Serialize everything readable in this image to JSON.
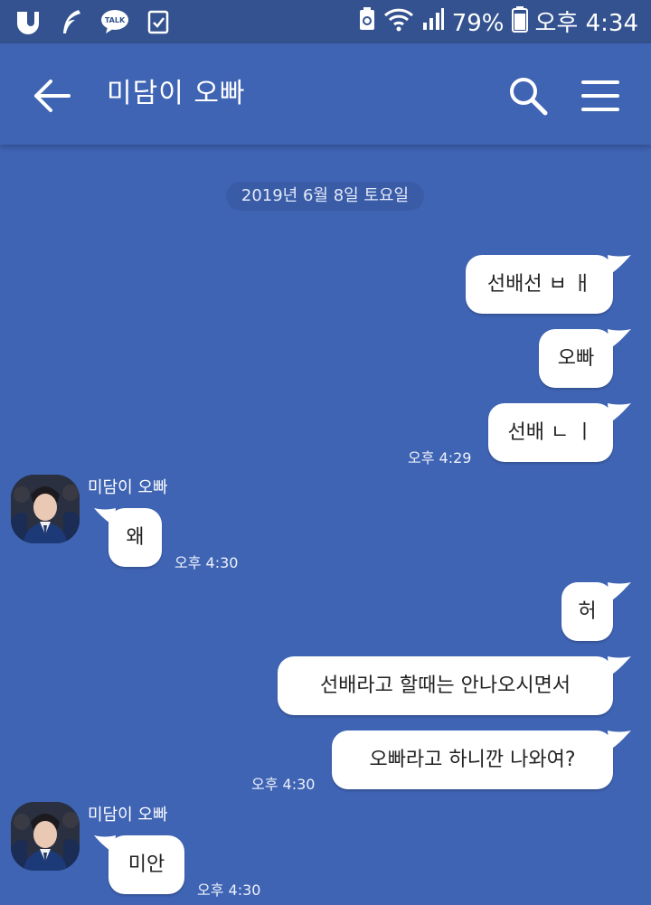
{
  "status_bar": {
    "battery": "79%",
    "time": "오후 4:34",
    "left_icons": [
      "u-plus-icon",
      "feather-icon",
      "talk-icon",
      "clipboard-check-icon"
    ],
    "right_icons": [
      "battery-saver-icon",
      "wifi-icon",
      "signal-icon",
      "battery-icon"
    ]
  },
  "header": {
    "title": "미담이 오빠",
    "back_icon": "arrow-left-icon",
    "search_icon": "search-icon",
    "menu_icon": "hamburger-menu-icon"
  },
  "chat": {
    "date": "2019년 6월 8일 토요일",
    "messages": [
      {
        "side": "right",
        "text": "선배선 ㅂ ㅐ"
      },
      {
        "side": "right",
        "text": "오빠"
      },
      {
        "side": "right",
        "text": "선배 ㄴ ㅣ",
        "time": "오후 4:29"
      },
      {
        "side": "left",
        "sender": "미담이 오빠",
        "text": "왜",
        "time": "오후 4:30"
      },
      {
        "side": "right",
        "text": "허"
      },
      {
        "side": "right",
        "text": "선배라고 할때는 안나오시면서"
      },
      {
        "side": "right",
        "text": "오빠라고 하니깐 나와여?",
        "time": "오후 4:30"
      },
      {
        "side": "left",
        "sender": "미담이 오빠",
        "text": "미안",
        "time": "오후 4:30"
      }
    ]
  },
  "colors": {
    "background": "#3f64b4",
    "status_bar": "#33528f",
    "bubble": "#ffffff"
  }
}
